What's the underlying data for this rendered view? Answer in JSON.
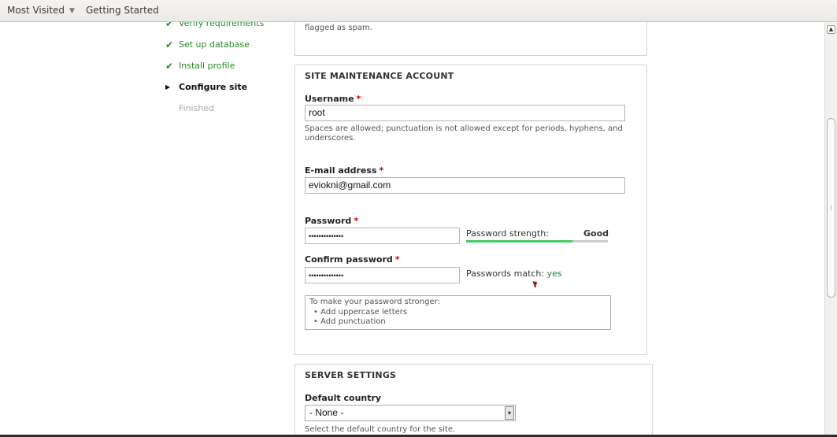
{
  "bookmarks": {
    "most_visited": "Most Visited",
    "getting_started": "Getting Started"
  },
  "steps": [
    {
      "label": "Verify requirements",
      "state": "done"
    },
    {
      "label": "Set up database",
      "state": "done"
    },
    {
      "label": "Install profile",
      "state": "done"
    },
    {
      "label": "Configure site",
      "state": "active"
    },
    {
      "label": "Finished",
      "state": "pending"
    }
  ],
  "prev_section": {
    "text": "flagged as spam."
  },
  "maintenance": {
    "title": "SITE MAINTENANCE ACCOUNT",
    "username_label": "Username",
    "username_value": "root",
    "username_help_1": "Spaces are allowed; punctuation is not allowed except for periods, hyphens, and",
    "username_help_2": "underscores.",
    "email_label": "E-mail address",
    "email_value": "eviokni@gmail.com",
    "password_label": "Password",
    "password_value": "••••••••••••••",
    "strength_label": "Password strength:",
    "strength_value": "Good",
    "strength_fraction": 0.75,
    "confirm_label": "Confirm password",
    "confirm_value": "••••••••••••••",
    "match_label": "Passwords match:",
    "match_value": "yes",
    "tips_title": "To make your password stronger:",
    "tips": [
      "Add uppercase letters",
      "Add punctuation"
    ],
    "required_mark": "*"
  },
  "server": {
    "title": "SERVER SETTINGS",
    "country_label": "Default country",
    "country_value": "- None -",
    "country_help": "Select the default country for the site."
  },
  "colors": {
    "done_green": "#2b8a2b",
    "strength_green": "#47c965",
    "required_red": "#cc0000"
  }
}
